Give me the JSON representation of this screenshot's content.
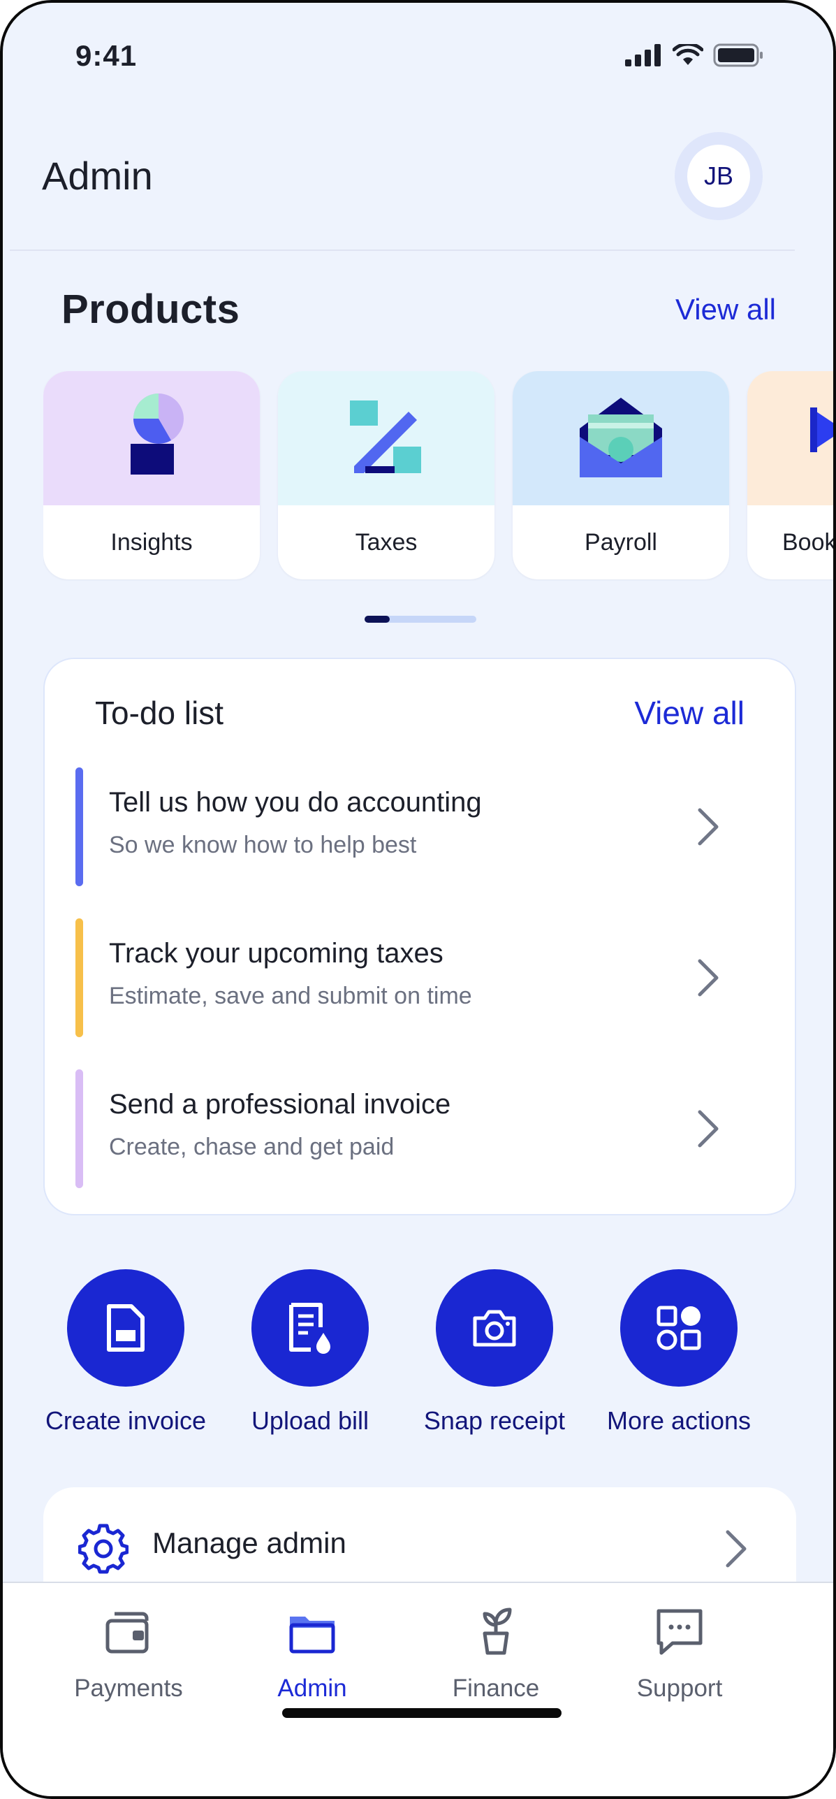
{
  "status_bar": {
    "time": "9:41"
  },
  "header": {
    "title": "Admin",
    "avatar_initials": "JB"
  },
  "products": {
    "title": "Products",
    "view_all": "View all",
    "items": [
      {
        "label": "Insights",
        "bg": "#eadcfb"
      },
      {
        "label": "Taxes",
        "bg": "#e2f6fb"
      },
      {
        "label": "Payroll",
        "bg": "#d3e8fb"
      },
      {
        "label": "Book",
        "bg": "#fdebd9"
      }
    ],
    "carousel_position": 0.22
  },
  "todo": {
    "title": "To-do list",
    "view_all": "View all",
    "items": [
      {
        "title": "Tell us how you do accounting",
        "subtitle": "So we know how to help best",
        "color": "#5a6cf0"
      },
      {
        "title": "Track your upcoming taxes",
        "subtitle": "Estimate, save and submit on time",
        "color": "#f7c04a"
      },
      {
        "title": "Send a professional invoice",
        "subtitle": "Create, chase and get paid",
        "color": "#d9bdf5"
      }
    ]
  },
  "quick_actions": [
    {
      "label": "Create invoice",
      "icon": "invoice-icon"
    },
    {
      "label": "Upload bill",
      "icon": "bill-upload-icon"
    },
    {
      "label": "Snap receipt",
      "icon": "camera-icon"
    },
    {
      "label": "More actions",
      "icon": "grid-shapes-icon"
    }
  ],
  "manage": {
    "label": "Manage admin"
  },
  "tabbar": {
    "items": [
      {
        "label": "Payments",
        "icon": "wallet-icon",
        "active": false
      },
      {
        "label": "Admin",
        "icon": "folder-icon",
        "active": true
      },
      {
        "label": "Finance",
        "icon": "plant-icon",
        "active": false
      },
      {
        "label": "Support",
        "icon": "chat-icon",
        "active": false
      }
    ]
  },
  "colors": {
    "accent": "#1a27d2",
    "background": "#eef3fd",
    "text": "#1c1f2a"
  }
}
